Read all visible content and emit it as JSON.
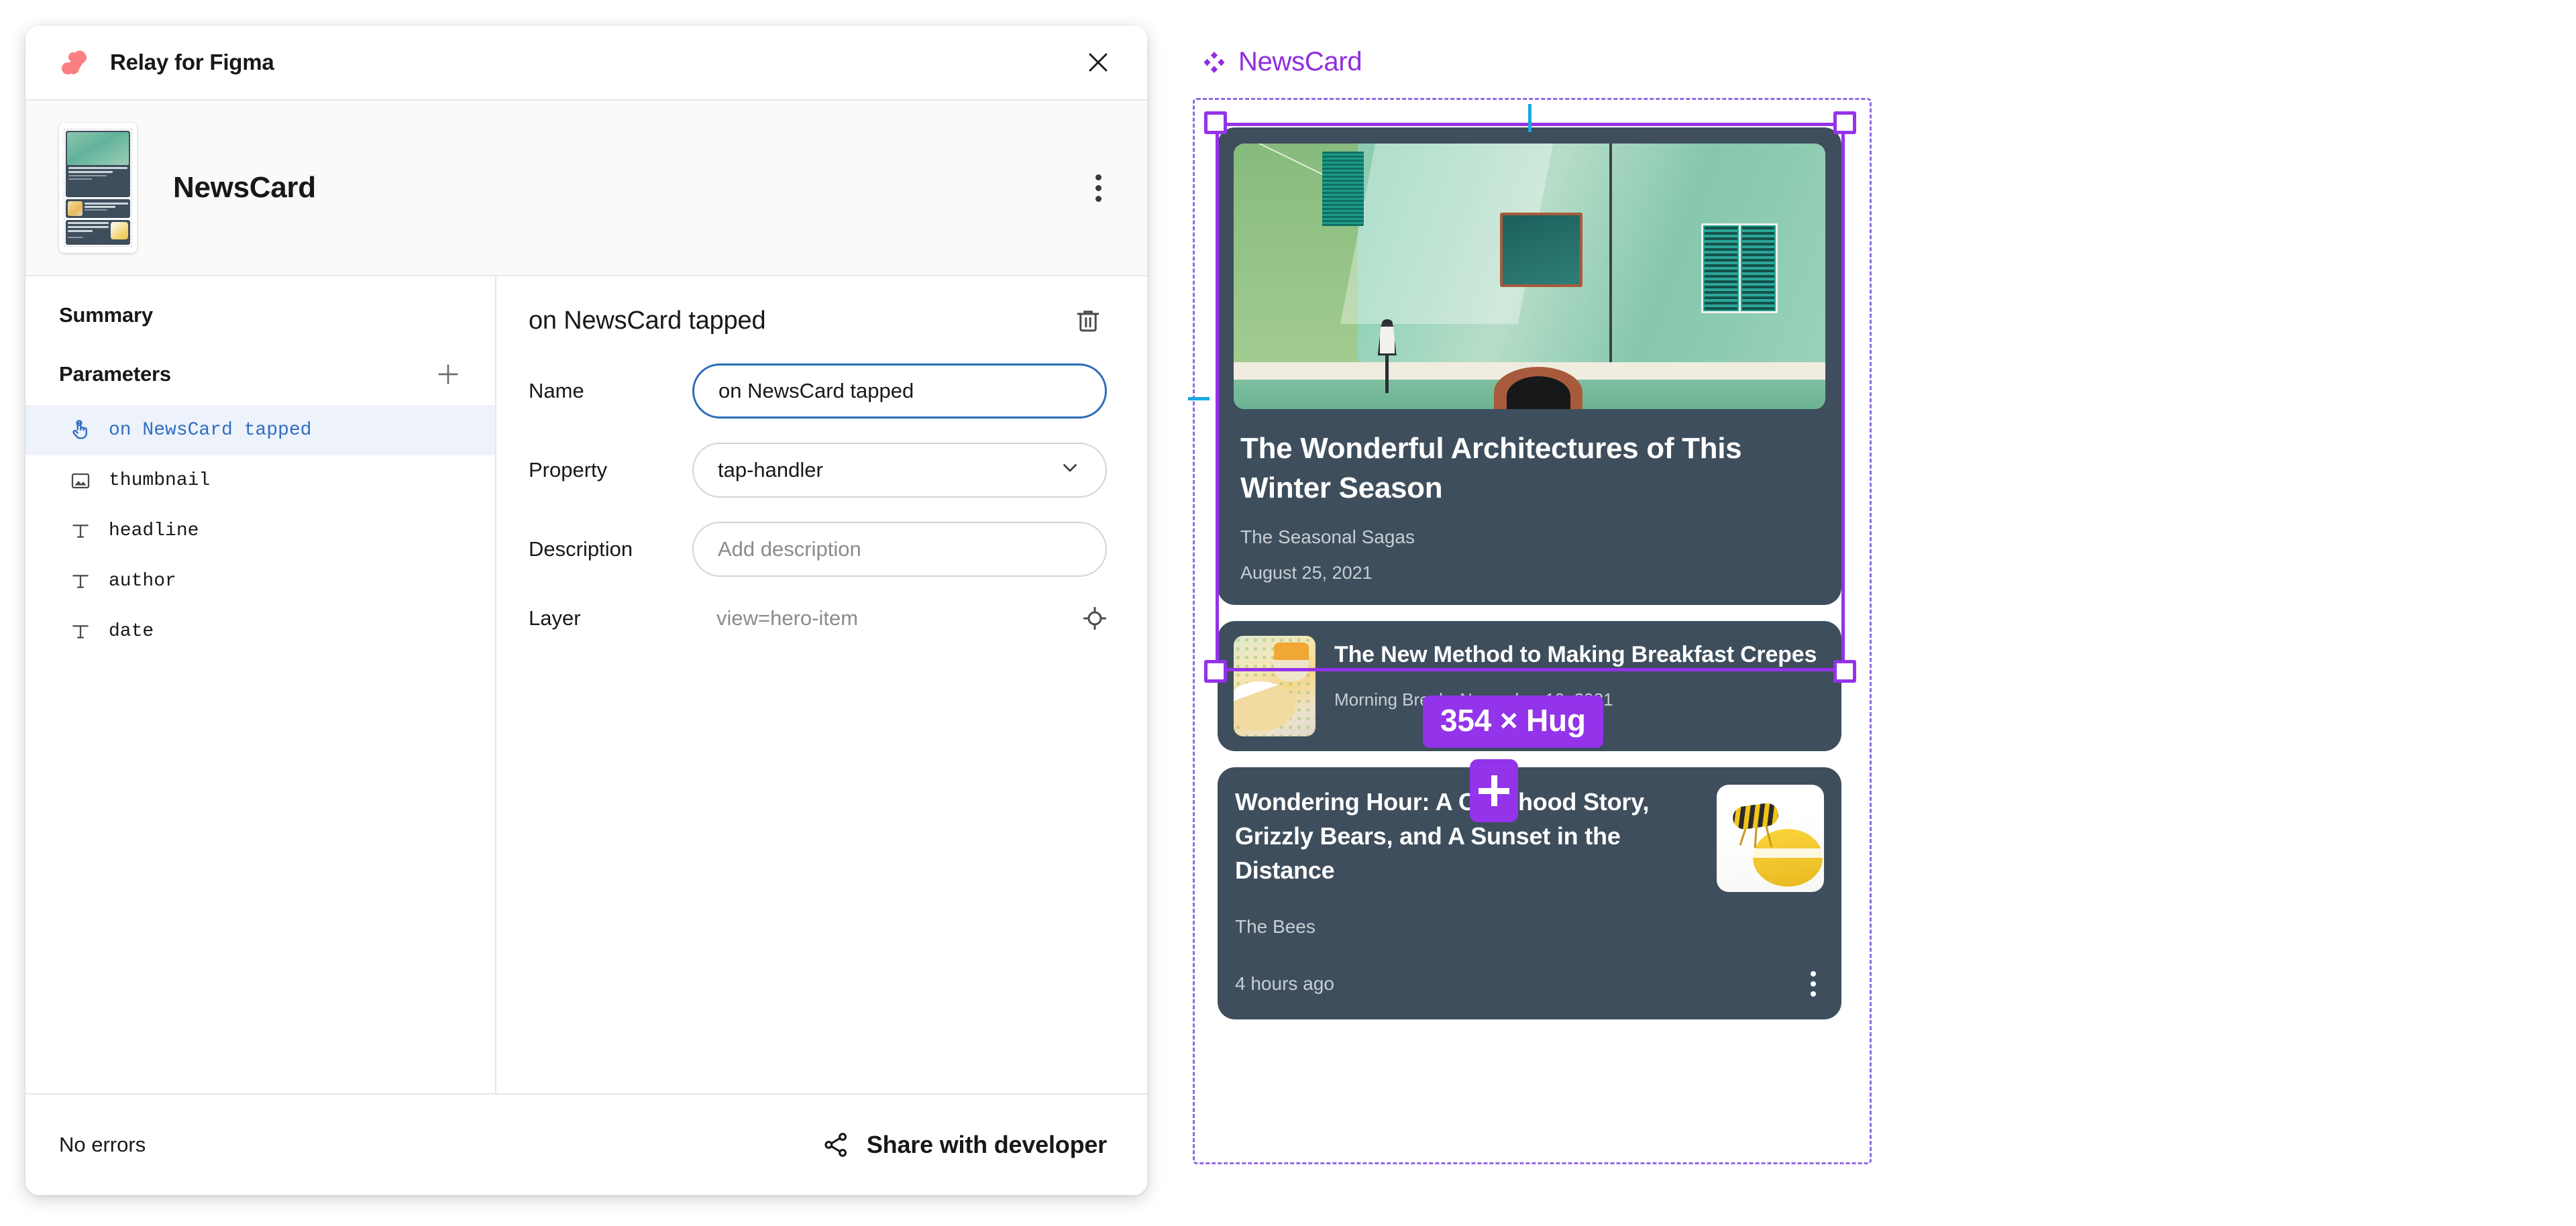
{
  "plugin": {
    "title": "Relay for Figma",
    "logo_color": "#FA8082",
    "close_icon": "close-icon",
    "component": {
      "name": "NewsCard",
      "kebab_icon": "more-vertical-icon"
    },
    "sidebar": {
      "summary_label": "Summary",
      "parameters_label": "Parameters",
      "add_icon": "plus-icon",
      "parameters": [
        {
          "label": "on NewsCard tapped",
          "icon": "tap-handler-icon",
          "selected": true
        },
        {
          "label": "thumbnail",
          "icon": "image-icon",
          "selected": false
        },
        {
          "label": "headline",
          "icon": "text-icon",
          "selected": false
        },
        {
          "label": "author",
          "icon": "text-icon",
          "selected": false
        },
        {
          "label": "date",
          "icon": "text-icon",
          "selected": false
        }
      ]
    },
    "detail": {
      "title": "on NewsCard tapped",
      "delete_icon": "trash-icon",
      "name_label": "Name",
      "name_value": "on NewsCard tapped",
      "property_label": "Property",
      "property_value": "tap-handler",
      "property_chevron": "chevron-down-icon",
      "description_label": "Description",
      "description_value": "",
      "description_placeholder": "Add description",
      "layer_label": "Layer",
      "layer_value": "view=hero-item",
      "layer_target_icon": "crosshair-icon"
    },
    "footer": {
      "status": "No errors",
      "share_label": "Share with developer",
      "share_icon": "share-icon"
    }
  },
  "canvas": {
    "frame_label": "NewsCard",
    "frame_label_color": "#8F2DE0",
    "frame_icon": "component-set-icon",
    "selection_color": "#9333EA",
    "guide_color": "#16A8E0",
    "size_badge": "354 × Hug",
    "add_badge_icon": "plus-icon",
    "cards": {
      "hero": {
        "image_alt": "green-building-facade",
        "headline": "The Wonderful Architectures of This Winter Season",
        "author": "The Seasonal Sagas",
        "date": "August 25, 2021"
      },
      "middle": {
        "image_alt": "breakfast-crepes",
        "headline": "The New Method to Making Breakfast Crepes",
        "author": "Morning Break",
        "date": "November 10, 2021"
      },
      "last": {
        "image_alt": "bee-on-lemon",
        "headline": "Wondering Hour: A Childhood Story, Grizzly Bears, and A Sunset in the Distance",
        "author": "The Bees",
        "date": "4 hours ago",
        "kebab_icon": "more-vertical-icon"
      }
    }
  }
}
